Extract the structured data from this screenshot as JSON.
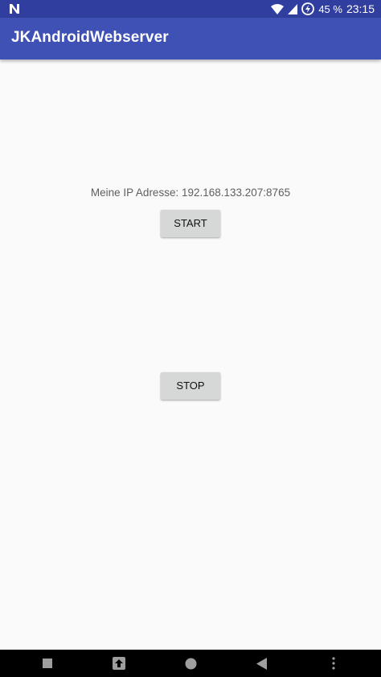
{
  "status_bar": {
    "battery_percent": "45 %",
    "time": "23:15",
    "icons": [
      "n-notification-icon",
      "wifi-icon",
      "signal-icon",
      "battery-icon"
    ]
  },
  "app_bar": {
    "title": "JKAndroidWebserver",
    "color": "#3f51b5"
  },
  "main": {
    "ip_label": "Meine IP Adresse: 192.168.133.207:8765",
    "start_label": "START",
    "stop_label": "STOP"
  },
  "nav_bar": {
    "icons": [
      "square-icon",
      "upload-icon",
      "home-circle-icon",
      "back-triangle-icon",
      "more-vert-icon"
    ]
  },
  "colors": {
    "status_bar": "#303f9f",
    "background": "#fafafa",
    "button": "#d6d7d7"
  }
}
